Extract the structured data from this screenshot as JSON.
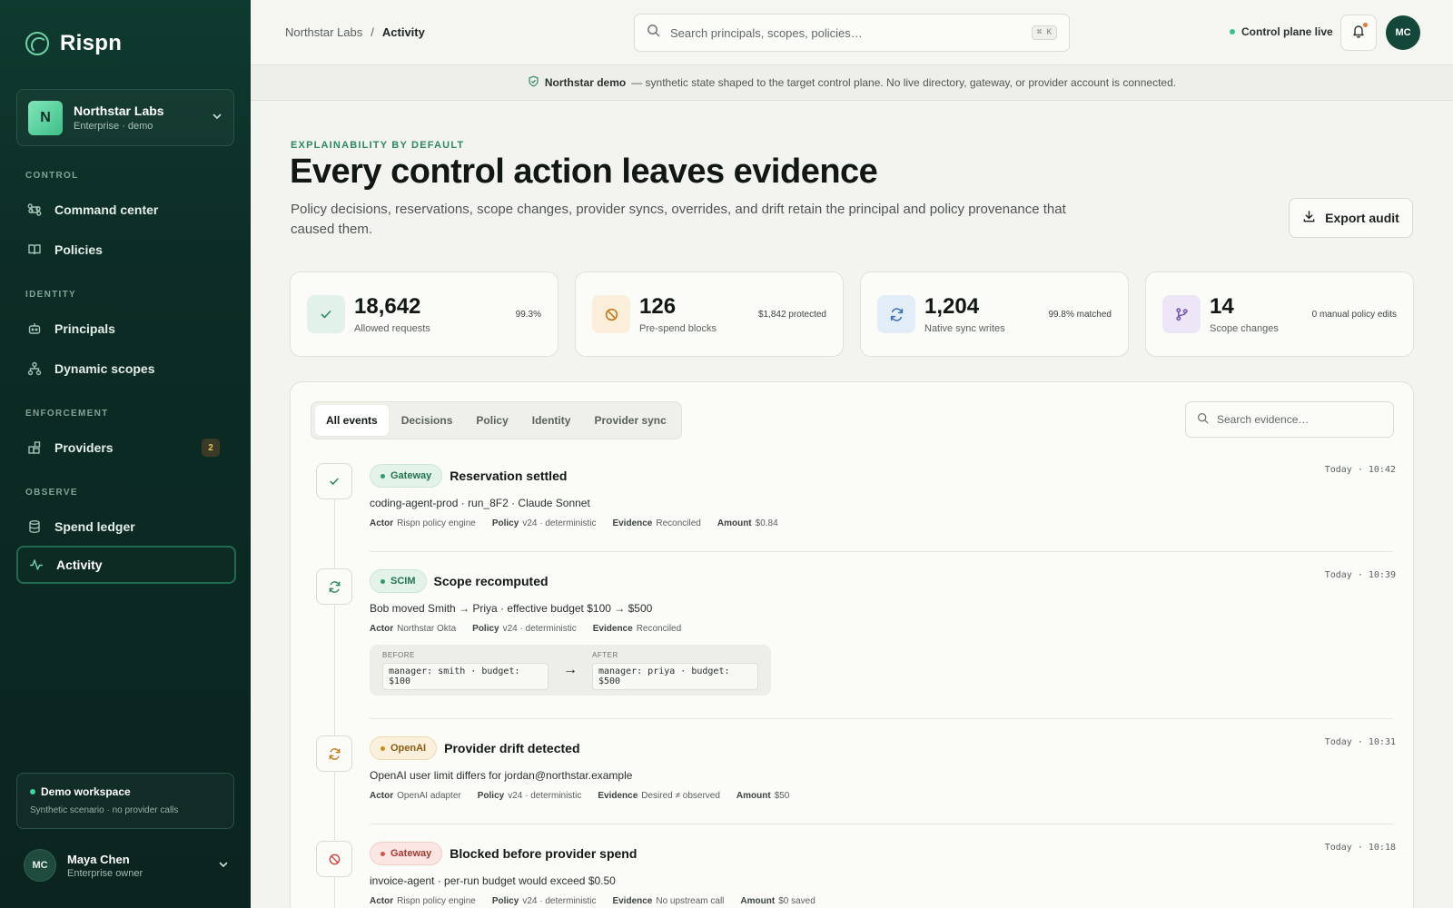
{
  "brand": {
    "name": "Rispn"
  },
  "org": {
    "initial": "N",
    "name": "Northstar Labs",
    "sub": "Enterprise · demo"
  },
  "nav": {
    "groups": [
      "CONTROL",
      "IDENTITY",
      "ENFORCEMENT",
      "OBSERVE"
    ],
    "items": [
      {
        "label": "Command center",
        "icon": "command-icon"
      },
      {
        "label": "Policies",
        "icon": "book-icon"
      },
      {
        "label": "Principals",
        "icon": "robot-icon"
      },
      {
        "label": "Dynamic scopes",
        "icon": "hierarchy-icon"
      },
      {
        "label": "Providers",
        "icon": "blocks-icon",
        "badge": "2"
      },
      {
        "label": "Spend ledger",
        "icon": "database-icon"
      },
      {
        "label": "Activity",
        "icon": "pulse-icon",
        "active": true
      }
    ]
  },
  "demo": {
    "title": "Demo workspace",
    "sub": "Synthetic scenario · no provider calls"
  },
  "user": {
    "initials": "MC",
    "name": "Maya Chen",
    "role": "Enterprise owner"
  },
  "topbar": {
    "crumb_root": "Northstar Labs",
    "crumb_sep": "/",
    "crumb_current": "Activity",
    "search_placeholder": "Search principals, scopes, policies…",
    "search_kbd": "⌘ K",
    "status": "Control plane live",
    "avatar_initials": "MC"
  },
  "banner": {
    "strong": "Northstar demo",
    "text": "— synthetic state shaped to the target control plane. No live directory, gateway, or provider account is connected."
  },
  "hero": {
    "eyebrow": "EXPLAINABILITY BY DEFAULT",
    "title": "Every control action leaves evidence",
    "desc": "Policy decisions, reservations, scope changes, provider syncs, overrides, and drift retain the principal and policy provenance that caused them.",
    "export_label": "Export audit"
  },
  "stats": [
    {
      "value": "18,642",
      "label": "Allowed requests",
      "note": "99.3%",
      "icon": "check-icon"
    },
    {
      "value": "126",
      "label": "Pre-spend blocks",
      "note": "$1,842 protected",
      "icon": "ban-icon"
    },
    {
      "value": "1,204",
      "label": "Native sync writes",
      "note": "99.8% matched",
      "icon": "sync-icon"
    },
    {
      "value": "14",
      "label": "Scope changes",
      "note": "0 manual policy edits",
      "icon": "branch-icon"
    }
  ],
  "colors": {
    "accent": "#2b8a62",
    "sidebar": "#0f3a2f",
    "warning": "#c98a1c",
    "danger": "#d1554b"
  },
  "tabs": [
    "All events",
    "Decisions",
    "Policy",
    "Identity",
    "Provider sync"
  ],
  "evidence_search_placeholder": "Search evidence…",
  "events": [
    {
      "tag": "Gateway",
      "title": "Reservation settled",
      "time": "Today · 10:42",
      "desc": "coding-agent-prod · run_8F2 · Claude Sonnet",
      "meta": [
        {
          "k": "Actor",
          "v": "Rispn policy engine"
        },
        {
          "k": "Policy",
          "v": "v24 · deterministic"
        },
        {
          "k": "Evidence",
          "v": "Reconciled"
        },
        {
          "k": "Amount",
          "v": "$0.84"
        }
      ]
    },
    {
      "tag": "SCIM",
      "title": "Scope recomputed",
      "time": "Today · 10:39",
      "desc": "Bob moved Smith → Priya · effective budget $100 → $500",
      "meta": [
        {
          "k": "Actor",
          "v": "Northstar Okta"
        },
        {
          "k": "Policy",
          "v": "v24 · deterministic"
        },
        {
          "k": "Evidence",
          "v": "Reconciled"
        }
      ],
      "diff": {
        "before_label": "BEFORE",
        "before": "manager: smith · budget: $100",
        "arrow": "→",
        "after_label": "AFTER",
        "after": "manager: priya · budget: $500"
      }
    },
    {
      "tag": "OpenAI",
      "title": "Provider drift detected",
      "time": "Today · 10:31",
      "desc": "OpenAI user limit differs for jordan@northstar.example",
      "meta": [
        {
          "k": "Actor",
          "v": "OpenAI adapter"
        },
        {
          "k": "Policy",
          "v": "v24 · deterministic"
        },
        {
          "k": "Evidence",
          "v": "Desired ≠ observed"
        },
        {
          "k": "Amount",
          "v": "$50"
        }
      ]
    },
    {
      "tag": "Gateway",
      "title": "Blocked before provider spend",
      "time": "Today · 10:18",
      "desc": "invoice-agent · per-run budget would exceed $0.50",
      "meta": [
        {
          "k": "Actor",
          "v": "Rispn policy engine"
        },
        {
          "k": "Policy",
          "v": "v24 · deterministic"
        },
        {
          "k": "Evidence",
          "v": "No upstream call"
        },
        {
          "k": "Amount",
          "v": "$0 saved"
        }
      ]
    }
  ]
}
